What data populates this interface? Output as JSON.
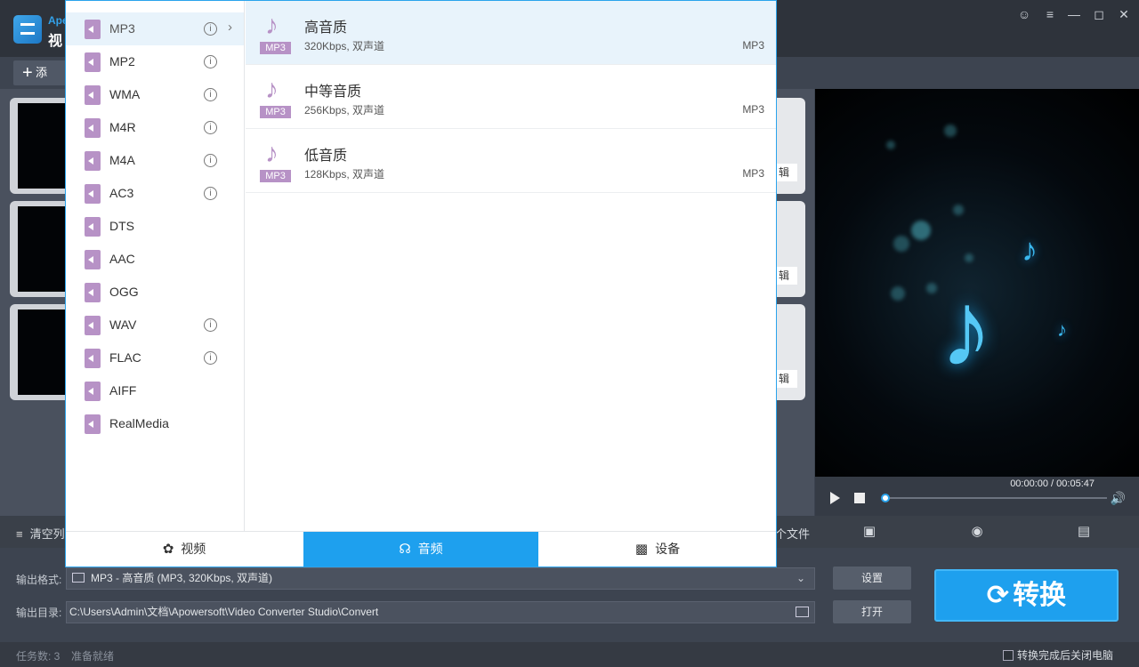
{
  "app": {
    "name": "Ape",
    "subtitle": "视"
  },
  "toolbar": {
    "add_label": "添"
  },
  "action_bar": {
    "clear_label": "清空列",
    "open_file_label": "个文件"
  },
  "rows": [
    {
      "edit_label": "辑"
    },
    {
      "edit_label": "辑"
    },
    {
      "edit_label": "辑"
    }
  ],
  "player": {
    "time": "00:00:00 / 00:05:47",
    "progress": 0.0
  },
  "format_list": [
    {
      "label": "MP3",
      "info": true,
      "selected": true
    },
    {
      "label": "MP2",
      "info": true
    },
    {
      "label": "WMA",
      "info": true
    },
    {
      "label": "M4R",
      "info": true
    },
    {
      "label": "M4A",
      "info": true
    },
    {
      "label": "AC3",
      "info": true
    },
    {
      "label": "DTS",
      "info": false
    },
    {
      "label": "AAC",
      "info": false
    },
    {
      "label": "OGG",
      "info": false
    },
    {
      "label": "WAV",
      "info": true
    },
    {
      "label": "FLAC",
      "info": true
    },
    {
      "label": "AIFF",
      "info": false
    },
    {
      "label": "RealMedia",
      "info": false
    }
  ],
  "presets": [
    {
      "name": "高音质",
      "desc": "320Kbps, 双声道",
      "format": "MP3",
      "tag": "MP3",
      "selected": true
    },
    {
      "name": "中等音质",
      "desc": "256Kbps, 双声道",
      "format": "MP3",
      "tag": "MP3"
    },
    {
      "name": "低音质",
      "desc": "128Kbps, 双声道",
      "format": "MP3",
      "tag": "MP3"
    }
  ],
  "tabs": [
    {
      "label": "视频",
      "icon": "film-reel-icon",
      "active": false
    },
    {
      "label": "音频",
      "icon": "headphones-icon",
      "active": true
    },
    {
      "label": "设备",
      "icon": "devices-icon",
      "active": false
    }
  ],
  "output": {
    "format_label": "输出格式:",
    "format_value": "MP3 - 高音质 (MP3, 320Kbps, 双声道)",
    "dir_label": "输出目录:",
    "dir_value": "C:\\Users\\Admin\\文档\\Apowersoft\\Video Converter Studio\\Convert",
    "settings_label": "设置",
    "open_label": "打开",
    "convert_label": "转换"
  },
  "status": {
    "task_count": "任务数: 3",
    "ready": "准备就绪",
    "shutdown_label": "转换完成后关闭电脑"
  },
  "colors": {
    "accent": "#1ea0ee",
    "audio_icon": "#b792c6",
    "selected_bg": "#e8f3fb"
  }
}
